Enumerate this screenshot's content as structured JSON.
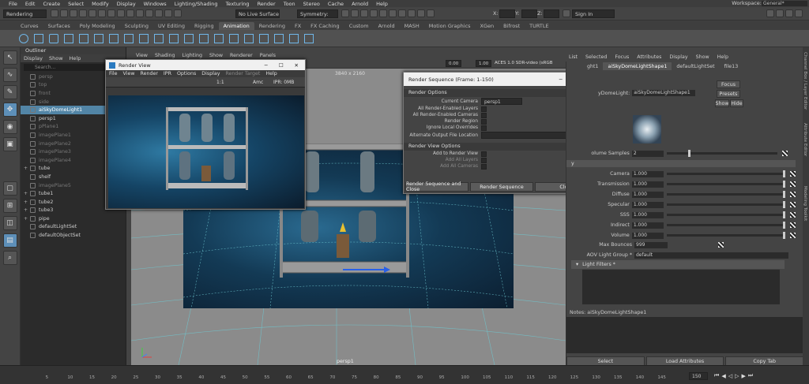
{
  "menubar": {
    "items": [
      "File",
      "Edit",
      "Create",
      "Select",
      "Modify",
      "Display",
      "Windows",
      "Lighting/Shading",
      "Texturing",
      "Render",
      "Toon",
      "Stereo",
      "Cache",
      "Arnold",
      "Help"
    ],
    "workspace_label": "Workspace:",
    "workspace_value": "General*"
  },
  "statusline": {
    "mode": "Rendering",
    "surface": "No Live Surface",
    "symmetry": "Symmetry: Off",
    "x": "X:",
    "y": "Y:",
    "z": "Z:",
    "signin": "Sign In"
  },
  "shelf": {
    "tabs": [
      "Curves",
      "Surfaces",
      "Poly Modeling",
      "Sculpting",
      "UV Editing",
      "Rigging",
      "Animation",
      "Rendering",
      "FX",
      "FX Caching",
      "Custom",
      "Arnold",
      "MASH",
      "Motion Graphics",
      "XGen",
      "Bifrost",
      "TURTLE"
    ],
    "active_tab": 6
  },
  "outliner": {
    "title": "Outliner",
    "menu": [
      "Display",
      "Show",
      "Help"
    ],
    "search_placeholder": "Search...",
    "items": [
      {
        "label": "persp",
        "dim": true,
        "sel": false,
        "expand": ""
      },
      {
        "label": "top",
        "dim": true,
        "sel": false,
        "expand": ""
      },
      {
        "label": "front",
        "dim": true,
        "sel": false,
        "expand": ""
      },
      {
        "label": "side",
        "dim": true,
        "sel": false,
        "expand": ""
      },
      {
        "label": "aiSkyDomeLight1",
        "dim": false,
        "sel": true,
        "expand": ""
      },
      {
        "label": "persp1",
        "dim": false,
        "sel": false,
        "expand": ""
      },
      {
        "label": "pPlane1",
        "dim": true,
        "sel": false,
        "expand": ""
      },
      {
        "label": "imagePlane1",
        "dim": true,
        "sel": false,
        "expand": ""
      },
      {
        "label": "imagePlane2",
        "dim": true,
        "sel": false,
        "expand": ""
      },
      {
        "label": "imagePlane3",
        "dim": true,
        "sel": false,
        "expand": ""
      },
      {
        "label": "imagePlane4",
        "dim": true,
        "sel": false,
        "expand": ""
      },
      {
        "label": "tube",
        "dim": false,
        "sel": false,
        "expand": "+"
      },
      {
        "label": "shelf",
        "dim": false,
        "sel": false,
        "expand": ""
      },
      {
        "label": "imagePlane5",
        "dim": true,
        "sel": false,
        "expand": ""
      },
      {
        "label": "tube1",
        "dim": false,
        "sel": false,
        "expand": "+"
      },
      {
        "label": "tube2",
        "dim": false,
        "sel": false,
        "expand": "+"
      },
      {
        "label": "tube3",
        "dim": false,
        "sel": false,
        "expand": "+"
      },
      {
        "label": "pipe",
        "dim": false,
        "sel": false,
        "expand": "+"
      },
      {
        "label": "defaultLightSet",
        "dim": false,
        "sel": false,
        "expand": ""
      },
      {
        "label": "defaultObjectSet",
        "dim": false,
        "sel": false,
        "expand": ""
      }
    ]
  },
  "viewport": {
    "menu": [
      "View",
      "Shading",
      "Lighting",
      "Show",
      "Renderer",
      "Panels"
    ],
    "resolution": "3840 x 2160",
    "camera": "persp1",
    "exposure": "0.00",
    "gamma": "1.00",
    "colorspace": "ACES 1.0 SDR-video (sRGB"
  },
  "render_view": {
    "title": "Render View",
    "menu": [
      "File",
      "View",
      "Render",
      "IPR",
      "Options",
      "Display",
      "Render Target",
      "Help"
    ],
    "ratio": "1:1",
    "ipr": "IPR: 0MB",
    "amc": "Amc"
  },
  "render_sequence": {
    "title": "Render Sequence (Frame: 1-150)",
    "section1": "Render Options",
    "current_camera_label": "Current Camera",
    "current_camera": "persp1",
    "options": [
      "All Render-Enabled Layers",
      "All Render-Enabled Cameras",
      "Render Region",
      "Ignore Local Overrides"
    ],
    "output_label": "Alternate Output File Location",
    "section2": "Render View Options",
    "view_options": [
      {
        "label": "Add to Render View",
        "disabled": false
      },
      {
        "label": "Add All Layers",
        "disabled": true
      },
      {
        "label": "Add All Cameras",
        "disabled": true
      }
    ],
    "btn_close_seq": "Render Sequence and Close",
    "btn_seq": "Render Sequence",
    "btn_close": "Close"
  },
  "attribute_editor": {
    "menu": [
      "List",
      "Selected",
      "Focus",
      "Attributes",
      "Display",
      "Show",
      "Help"
    ],
    "tabs": [
      "ght1",
      "aiSkyDomeLightShape1",
      "defaultLightSet",
      "file13"
    ],
    "node_label": "yDomeLight:",
    "node_value": "aiSkyDomeLightShape1",
    "focus": "Focus",
    "presets": "Presets",
    "show": "Show",
    "hide": "Hide",
    "samples_label": "olume Samples",
    "samples_value": "2",
    "attrs": [
      {
        "label": "Camera",
        "value": "1.000"
      },
      {
        "label": "Transmission",
        "value": "1.000"
      },
      {
        "label": "Diffuse",
        "value": "1.000"
      },
      {
        "label": "Specular",
        "value": "1.000"
      },
      {
        "label": "SSS",
        "value": "1.000"
      },
      {
        "label": "Indirect",
        "value": "1.000"
      },
      {
        "label": "Volume",
        "value": "1.000"
      }
    ],
    "max_bounces_label": "Max Bounces",
    "max_bounces": "999",
    "aov_label": "AOV Light Group *",
    "aov_value": "default",
    "light_filters": "Light Filters *",
    "notes": "Notes: aiSkyDomeLightShape1",
    "btn_select": "Select",
    "btn_load": "Load Attributes",
    "btn_copy": "Copy Tab",
    "side_tabs": [
      "Channel Box / Layer Editor",
      "Attribute Editor",
      "Modeling Toolkit"
    ]
  },
  "timeslider": {
    "ticks": [
      "5",
      "10",
      "15",
      "20",
      "25",
      "30",
      "35",
      "40",
      "45",
      "50",
      "55",
      "60",
      "65",
      "70",
      "75",
      "80",
      "85",
      "90",
      "95",
      "100",
      "105",
      "110",
      "115",
      "120",
      "125",
      "130",
      "135",
      "140",
      "145"
    ],
    "end_frame": "150"
  },
  "colors": {
    "accent": "#5285a6",
    "shelf_icon": "#6fb6e8"
  }
}
